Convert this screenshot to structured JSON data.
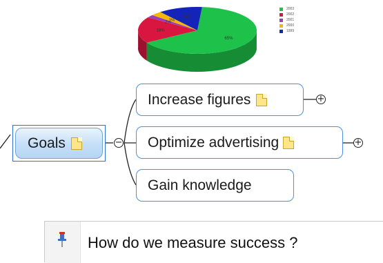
{
  "chart_data": {
    "type": "pie",
    "labels": [
      "2003",
      "2002",
      "2001",
      "2000",
      "1999"
    ],
    "colors": [
      "#1ec24a",
      "#d9163f",
      "#9b3fb5",
      "#f5b800",
      "#1424b8"
    ],
    "slices": [
      {
        "label": "65%",
        "value": 65,
        "color": "#1ec24a"
      },
      {
        "label": "18%",
        "value": 18,
        "color": "#d9163f"
      },
      {
        "label": "2%",
        "value": 2,
        "color": "#9b3fb5"
      },
      {
        "label": "3%",
        "value": 3,
        "color": "#f5b800"
      },
      {
        "label": "16%",
        "value": 12,
        "color": "#1424b8"
      }
    ]
  },
  "mindmap": {
    "central": {
      "label": "Goals"
    },
    "branches": [
      {
        "label": "Increase figures"
      },
      {
        "label": "Optimize advertising"
      },
      {
        "label": "Gain knowledge"
      }
    ]
  },
  "callout": {
    "text": "How do we measure success ?"
  },
  "icons": {
    "note": "note-icon",
    "pin": "pushpin-icon",
    "expand": "plus-circle-icon",
    "collapse": "minus-circle-icon"
  }
}
